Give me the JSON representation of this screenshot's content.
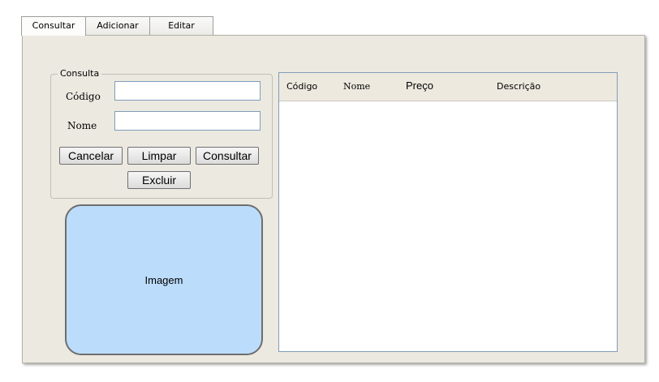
{
  "tabs": [
    "Consultar",
    "Adicionar",
    "Editar"
  ],
  "consulta": {
    "legend": "Consulta",
    "codigo_label": "Código",
    "codigo_value": "",
    "nome_label": "Nome",
    "nome_value": ""
  },
  "buttons": {
    "cancelar": "Cancelar",
    "limpar": "Limpar",
    "consultar": "Consultar",
    "excluir": "Excluir"
  },
  "image_label": "Imagem",
  "table": {
    "columns": [
      "Código",
      "Nome",
      "Preço",
      "Descrição"
    ],
    "rows": []
  },
  "colors": {
    "panel": "#ece9e1",
    "image_placeholder": "#bcdcfb",
    "table_header": "#ede9df"
  }
}
